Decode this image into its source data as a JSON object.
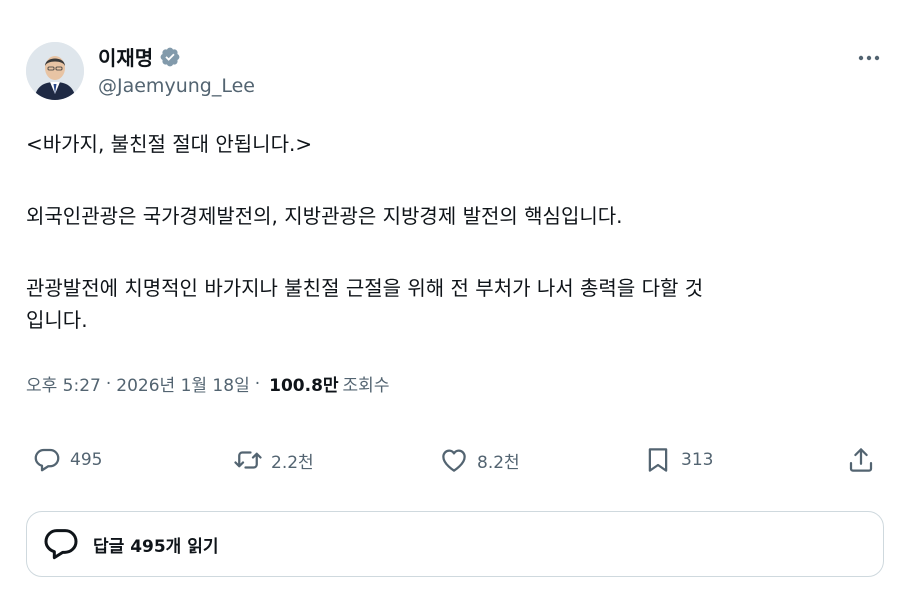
{
  "author": {
    "name": "이재명",
    "handle": "@Jaemyung_Lee"
  },
  "tweet": {
    "lines": [
      "<바가지, 불친절 절대 안됩니다.>",
      "외국인관광은 국가경제발전의, 지방관광은 지방경제 발전의 핵심입니다.",
      "관광발전에 치명적인 바가지나 불친절 근절을 위해 전 부처가 나서 총력을 다할 것",
      "입니다."
    ]
  },
  "meta": {
    "time": "오후 5:27",
    "date": "2026년 1월 18일",
    "separator": "·",
    "views": "100.8만",
    "views_label": "조회수"
  },
  "actions": {
    "replies": "495",
    "retweets": "2.2천",
    "likes": "8.2천",
    "bookmarks": "313"
  },
  "read_replies": {
    "label": "답글 495개 읽기"
  },
  "colors": {
    "text": "#0f1419",
    "secondary": "#536471",
    "border": "#cfd9de",
    "verified": "#829aab"
  },
  "icons": [
    "verified-badge-icon",
    "more-icon",
    "reply-icon",
    "retweet-icon",
    "like-icon",
    "bookmark-icon",
    "share-icon",
    "chat-bubble-icon"
  ]
}
